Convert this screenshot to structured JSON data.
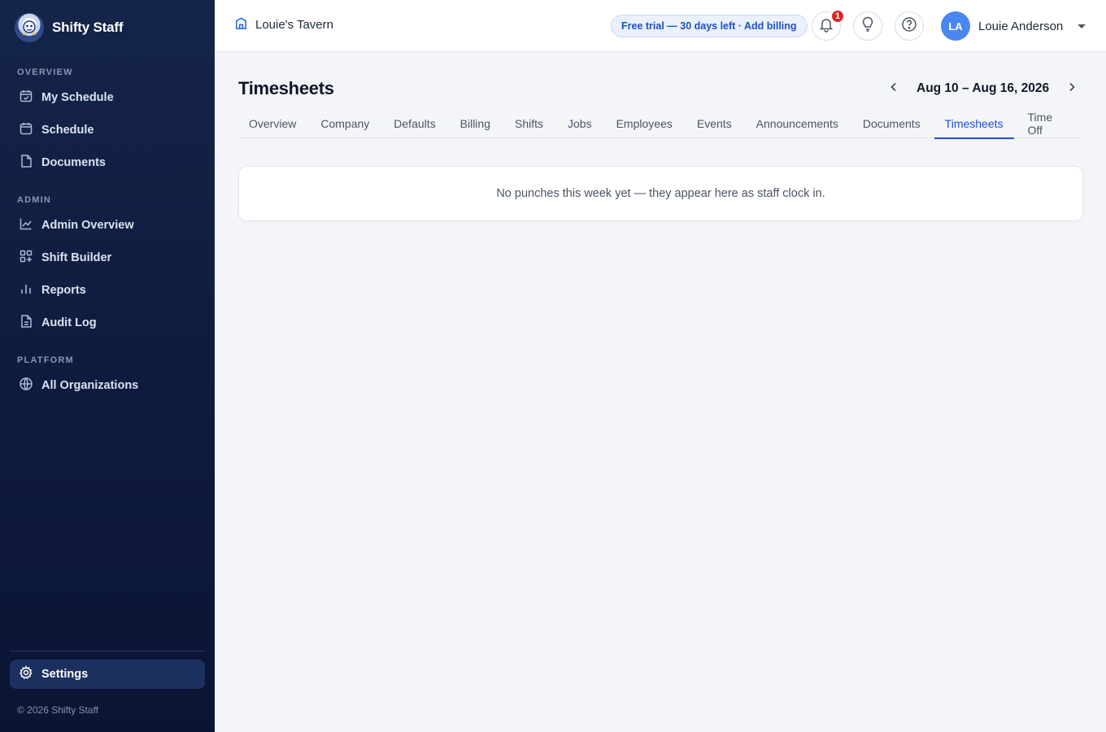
{
  "brand": {
    "name": "Shifty Staff"
  },
  "sidebar": {
    "sections": {
      "overview": "OVERVIEW",
      "admin": "ADMIN",
      "platform": "PLATFORM"
    },
    "items": [
      {
        "label": "My Schedule",
        "icon": "calendar-check-icon"
      },
      {
        "label": "Schedule",
        "icon": "calendar-icon"
      },
      {
        "label": "Documents",
        "icon": "document-icon"
      },
      {
        "label": "Admin Overview",
        "icon": "line-chart-icon"
      },
      {
        "label": "Shift Builder",
        "icon": "grid-plus-icon"
      },
      {
        "label": "Reports",
        "icon": "bar-chart-icon"
      },
      {
        "label": "Audit Log",
        "icon": "file-text-icon"
      },
      {
        "label": "All Organizations",
        "icon": "globe-icon"
      }
    ],
    "settings": {
      "label": "Settings",
      "icon": "gear-icon",
      "active": true
    },
    "copyright": "© 2026 Shifty Staff"
  },
  "topbar": {
    "org_name": "Louie's Tavern",
    "trial_banner": "Free trial — 30 days left · Add billing",
    "notifications_count": "1",
    "user": {
      "initials": "LA",
      "name": "Louie Anderson"
    }
  },
  "main": {
    "title": "Timesheets",
    "week_range": "Aug 10 – Aug 16, 2026",
    "tabs": [
      {
        "label": "Overview"
      },
      {
        "label": "Company"
      },
      {
        "label": "Defaults"
      },
      {
        "label": "Billing"
      },
      {
        "label": "Shifts"
      },
      {
        "label": "Jobs"
      },
      {
        "label": "Employees"
      },
      {
        "label": "Events"
      },
      {
        "label": "Announcements"
      },
      {
        "label": "Documents"
      },
      {
        "label": "Timesheets",
        "active": true
      },
      {
        "label": "Time Off"
      }
    ],
    "empty_message": "No punches this week yet — they appear here as staff clock in."
  },
  "colors": {
    "sidebar_bg": "#0e1a3c",
    "accent": "#1d4ed8",
    "badge": "#dc2626",
    "avatar": "#4a86f0"
  }
}
